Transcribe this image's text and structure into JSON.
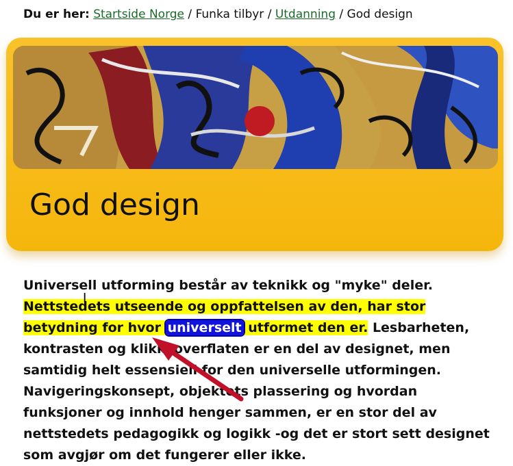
{
  "breadcrumb": {
    "prefix": "Du er her:",
    "items": [
      {
        "label": "Startside Norge",
        "link": true
      },
      {
        "label": "Funka tilbyr",
        "link": false
      },
      {
        "label": "Utdanning",
        "link": true
      },
      {
        "label": "God design",
        "link": false
      }
    ],
    "separator": "/"
  },
  "banner": {
    "title": "God design",
    "image_icon": "graffiti-image"
  },
  "content": {
    "part1": "Universell utforming består av teknikk og \"myke\" deler.",
    "highlight_before": "Nettstedets utseende og oppfattelsen av den, har stor betydning for hvor",
    "selected_word": "universelt",
    "highlight_after": "utformet den er.",
    "part2": "Lesbarheten, kontrasten og klikkeoverflaten er en del av designet, men samtidig helt essensiell for den universelle utformingen. Navigeringskonsept, objektets plassering og hvordan funksjoner og innhold henger sammen, er en stor del av nettstedets pedagogikk og logikk -og det er stort sett designet som avgjør om det fungerer eller ikke."
  },
  "annotation": {
    "arrow_icon": "red-arrow-icon",
    "arrow_color": "#c0102a",
    "cursor_icon": "text-cursor-icon"
  },
  "colors": {
    "banner": "#f8bc1a",
    "highlight": "#ffff00",
    "selection": "#1212dd",
    "link": "#1a6a2a"
  }
}
